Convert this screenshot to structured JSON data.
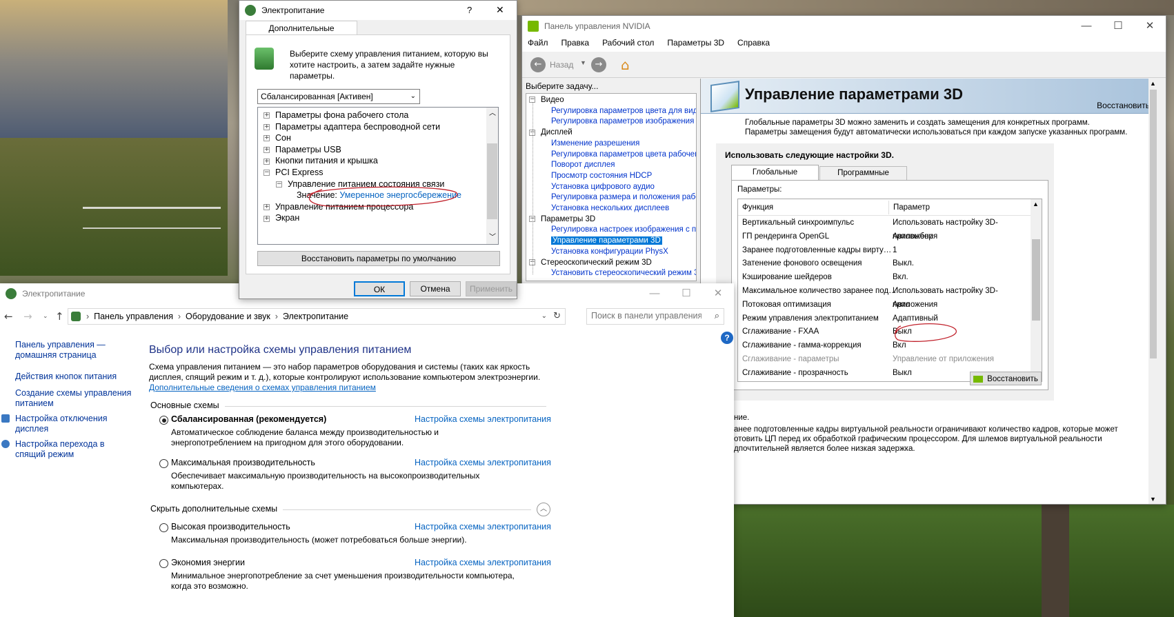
{
  "power_dialog": {
    "title": "Электропитание",
    "help": "?",
    "close": "✕",
    "tab": "Дополнительные параметры",
    "intro": "Выберите схему управления питанием, которую вы хотите настроить, а затем задайте нужные параметры.",
    "scheme_select": "Сбалансированная [Активен]",
    "tree": [
      {
        "label": "Параметры фона рабочего стола",
        "exp": "+"
      },
      {
        "label": "Параметры адаптера беспроводной сети",
        "exp": "+"
      },
      {
        "label": "Сон",
        "exp": "+"
      },
      {
        "label": "Параметры USB",
        "exp": "+"
      },
      {
        "label": "Кнопки питания и крышка",
        "exp": "+"
      },
      {
        "label": "PCI Express",
        "exp": "−"
      },
      {
        "label": "Управление питанием состояния связи",
        "exp": "−"
      },
      {
        "label": "Управление питанием процессора",
        "exp": "+"
      },
      {
        "label": "Экран",
        "exp": "+"
      }
    ],
    "value_label": "Значение:",
    "value": "Умеренное энергосбережение",
    "restore_defaults": "Восстановить параметры по умолчанию",
    "ok": "ОК",
    "cancel": "Отмена",
    "apply": "Применить"
  },
  "control_panel": {
    "title": "Электропитание",
    "min": "—",
    "max": "☐",
    "close": "✕",
    "breadcrumb": [
      "Панель управления",
      "Оборудование и звук",
      "Электропитание"
    ],
    "search_placeholder": "Поиск в панели управления",
    "sidebar": [
      "Панель управления — домашняя страница",
      "Действия кнопок питания",
      "Создание схемы управления питанием",
      "Настройка отключения дисплея",
      "Настройка перехода в спящий режим"
    ],
    "heading": "Выбор или настройка схемы управления питанием",
    "desc": "Схема управления питанием — это набор параметров оборудования и системы (таких как яркость дисплея, спящий режим и т. д.), которые контролируют использование компьютером электроэнергии.",
    "more_link": "Дополнительные сведения о схемах управления питанием",
    "main_section": "Основные схемы",
    "hidden_section": "Скрыть дополнительные схемы",
    "plans": [
      {
        "name": "Сбалансированная (рекомендуется)",
        "selected": true,
        "desc": "Автоматическое соблюдение баланса между производительностью и энергопотреблением на пригодном для этого оборудовании.",
        "link": "Настройка схемы электропитания"
      },
      {
        "name": "Максимальная производительность",
        "selected": false,
        "desc": "Обеспечивает максимальную производительность на высокопроизводительных компьютерах.",
        "link": "Настройка схемы электропитания"
      },
      {
        "name": "Высокая производительность",
        "selected": false,
        "desc": "Максимальная производительность (может потребоваться больше энергии).",
        "link": "Настройка схемы электропитания"
      },
      {
        "name": "Экономия энергии",
        "selected": false,
        "desc": "Минимальное энергопотребление за счет уменьшения производительности компьютера, когда это возможно.",
        "link": "Настройка схемы электропитания"
      }
    ]
  },
  "nvidia": {
    "title": "Панель управления NVIDIA",
    "min": "—",
    "max": "☐",
    "close": "✕",
    "menu": [
      "Файл",
      "Правка",
      "Рабочий стол",
      "Параметры 3D",
      "Справка"
    ],
    "back": "Назад",
    "task_label": "Выберите задачу...",
    "tree": [
      {
        "type": "cat",
        "label": "Видео"
      },
      {
        "type": "item",
        "label": "Регулировка параметров цвета для вид"
      },
      {
        "type": "item",
        "label": "Регулировка параметров изображения д"
      },
      {
        "type": "cat",
        "label": "Дисплей"
      },
      {
        "type": "item",
        "label": "Изменение разрешения"
      },
      {
        "type": "item",
        "label": "Регулировка параметров цвета рабочег"
      },
      {
        "type": "item",
        "label": "Поворот дисплея"
      },
      {
        "type": "item",
        "label": "Просмотр состояния HDCP"
      },
      {
        "type": "item",
        "label": "Установка цифрового аудио"
      },
      {
        "type": "item",
        "label": "Регулировка размера и положения рабо"
      },
      {
        "type": "item",
        "label": "Установка нескольких дисплеев"
      },
      {
        "type": "cat",
        "label": "Параметры 3D"
      },
      {
        "type": "item",
        "label": "Регулировка настроек изображения с пр"
      },
      {
        "type": "sel",
        "label": "Управление параметрами 3D"
      },
      {
        "type": "item",
        "label": "Установка конфигурации PhysX"
      },
      {
        "type": "cat",
        "label": "Стереоскопический режим 3D"
      },
      {
        "type": "item",
        "label": "Установить стереоскопический режим 3"
      }
    ],
    "page_title": "Управление параметрами 3D",
    "restore": "Восстановить",
    "intro": "Глобальные параметры 3D можно заменить и создать замещения для конкретных программ. Параметры замещения будут автоматически использоваться при каждом запуске указанных программ.",
    "use_settings": "Использовать следующие настройки 3D.",
    "tabs": [
      "Глобальные параметры",
      "Программные настройки"
    ],
    "params_label": "Параметры:",
    "col_func": "Функция",
    "col_param": "Параметр",
    "rows": [
      {
        "f": "Вертикальный синхроимпульс",
        "p": "Использовать настройку 3D-приложения",
        "dim": false
      },
      {
        "f": "ГП рендеринга OpenGL",
        "p": "Автовыбор",
        "dim": false
      },
      {
        "f": "Заранее подготовленные кадры вирту…",
        "p": "1",
        "dim": false
      },
      {
        "f": "Затенение фонового освещения",
        "p": "Выкл.",
        "dim": false
      },
      {
        "f": "Кэширование шейдеров",
        "p": "Вкл.",
        "dim": false
      },
      {
        "f": "Максимальное количество заранее под…",
        "p": "Использовать настройку 3D-приложения",
        "dim": false
      },
      {
        "f": "Потоковая оптимизация",
        "p": "Авто",
        "dim": false
      },
      {
        "f": "Режим управления электропитанием",
        "p": "Адаптивный",
        "dim": false
      },
      {
        "f": "Сглаживание - FXAA",
        "p": "Выкл",
        "dim": false
      },
      {
        "f": "Сглаживание - гамма-коррекция",
        "p": "Вкл",
        "dim": false
      },
      {
        "f": "Сглаживание - параметры",
        "p": "Управление от приложения",
        "dim": true
      },
      {
        "f": "Сглаживание - прозрачность",
        "p": "Выкл",
        "dim": false
      }
    ],
    "restore_btn": "Восстановить",
    "desc_label": "ние.",
    "desc": "анее подготовленные кадры виртуальной реальности ограничивают количество кадров, которые может отовить ЦП перед их обработкой графическим процессором. Для шлемов виртуальной реальности дпочтительней является более низкая задержка."
  },
  "colors": {
    "link": "#0563c1",
    "nv_green": "#76b900",
    "nv_header": "#bcd3e8",
    "selection": "#0078d7"
  }
}
